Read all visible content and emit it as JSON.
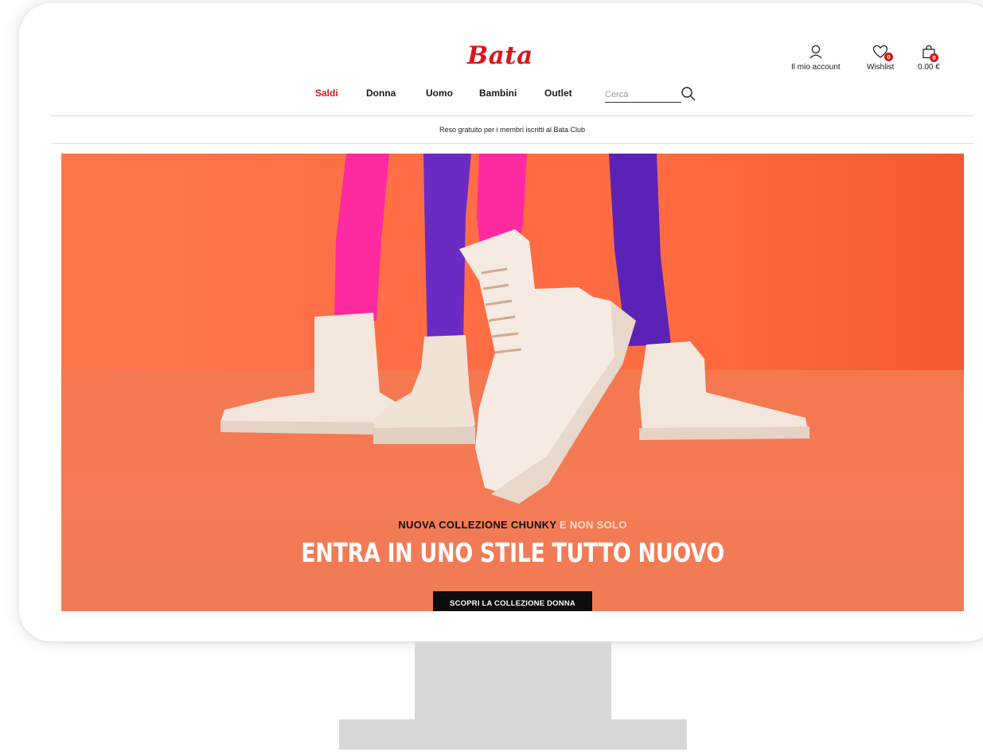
{
  "brand": {
    "logo_text": "Bata"
  },
  "account_links": {
    "account_label": "Il mio account",
    "wishlist_label": "Wishlist",
    "wishlist_count": "0",
    "cart_total": "0.00 €",
    "cart_count": "0"
  },
  "nav": {
    "items": [
      {
        "label": "Saldi"
      },
      {
        "label": "Donna"
      },
      {
        "label": "Uomo"
      },
      {
        "label": "Bambini"
      },
      {
        "label": "Outlet"
      }
    ]
  },
  "search": {
    "placeholder": "Cerca",
    "value": ""
  },
  "promo_bar": {
    "text": "Reso gratuito per i membri iscritti al Bata Club"
  },
  "hero": {
    "subtitle_main": "NUOVA COLLEZIONE CHUNKY",
    "subtitle_accent": "E NON SOLO",
    "title": "ENTRA IN UNO STILE TUTTO NUOVO",
    "cta_label": "SCOPRI LA COLLEZIONE DONNA"
  },
  "colors": {
    "brand_red": "#d9161d",
    "hero_orange": "#ff6e45",
    "tights_pink": "#ff2aa0",
    "tights_purple": "#5b22b5",
    "boot_cream": "#f3e6dc"
  }
}
